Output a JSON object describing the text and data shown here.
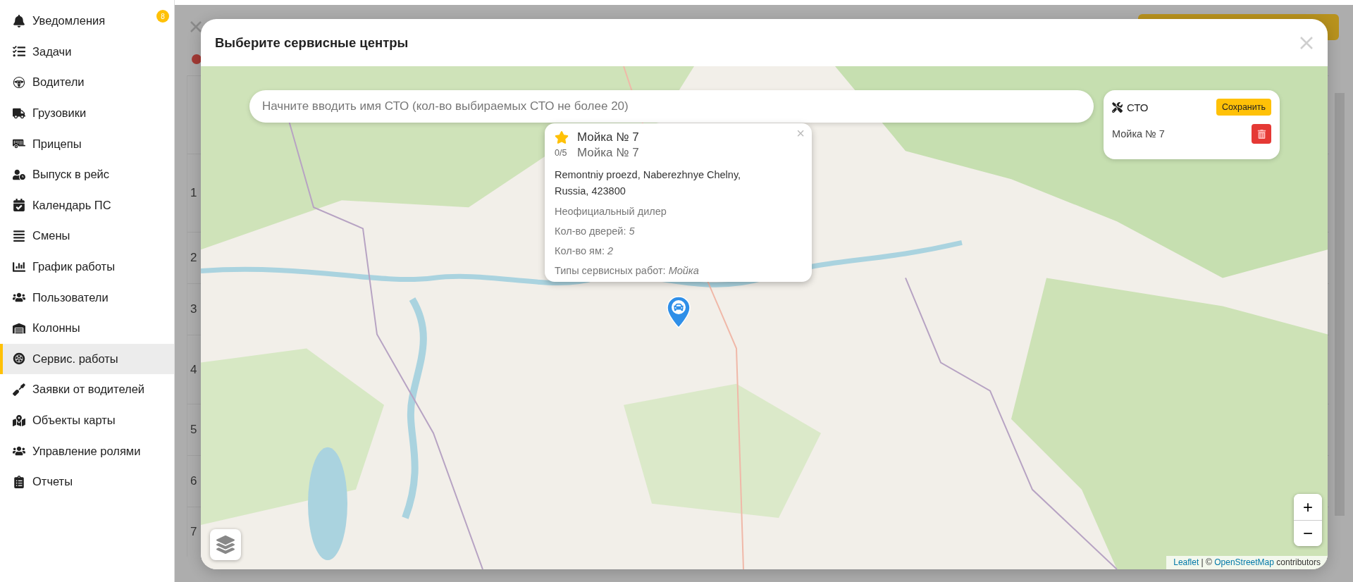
{
  "sidebar": {
    "items": [
      {
        "label": "Уведомления",
        "selected": false,
        "badge": "8"
      },
      {
        "label": "Задачи",
        "selected": false
      },
      {
        "label": "Водители",
        "selected": false
      },
      {
        "label": "Грузовики",
        "selected": false
      },
      {
        "label": "Прицепы",
        "selected": false
      },
      {
        "label": "Выпуск в рейс",
        "selected": false
      },
      {
        "label": "Календарь ПС",
        "selected": false
      },
      {
        "label": "Смены",
        "selected": false
      },
      {
        "label": "График работы",
        "selected": false
      },
      {
        "label": "Пользователи",
        "selected": false
      },
      {
        "label": "Колонны",
        "selected": false
      },
      {
        "label": "Сервис. работы",
        "selected": true
      },
      {
        "label": "Заявки от водителей",
        "selected": false
      },
      {
        "label": "Объекты карты",
        "selected": false
      },
      {
        "label": "Управление ролями",
        "selected": false
      },
      {
        "label": "Отчеты",
        "selected": false
      }
    ]
  },
  "background": {
    "row_numbers": [
      "1",
      "2",
      "3",
      "4",
      "5",
      "6",
      "7"
    ]
  },
  "modal": {
    "title": "Выберите сервисные центры",
    "search": {
      "placeholder": "Начните вводить имя СТО (кол-во выбираемых СТО не более 20)"
    },
    "selection_panel": {
      "title": "СТО",
      "save_button": "Сохранить",
      "items": [
        {
          "name": "Мойка № 7"
        }
      ]
    },
    "popup": {
      "title": "Мойка № 7",
      "rating": "0/5",
      "subtitle": "Мойка № 7",
      "close": "×",
      "address": "Remontniy proezd, Naberezhnye Chelny, Russia, 423800",
      "dealer": "Неофициальный дилер",
      "fields": [
        "Кол-во дверей: *5*",
        "Кол-во ям: *2*",
        "Типы сервисных работ: *Мойка*"
      ]
    },
    "zoom": {
      "in": "+",
      "out": "−"
    },
    "attribution": {
      "leaflet": "Leaflet",
      "middle": "| ©",
      "osm": "OpenStreetMap",
      "rest": "contributors"
    }
  }
}
